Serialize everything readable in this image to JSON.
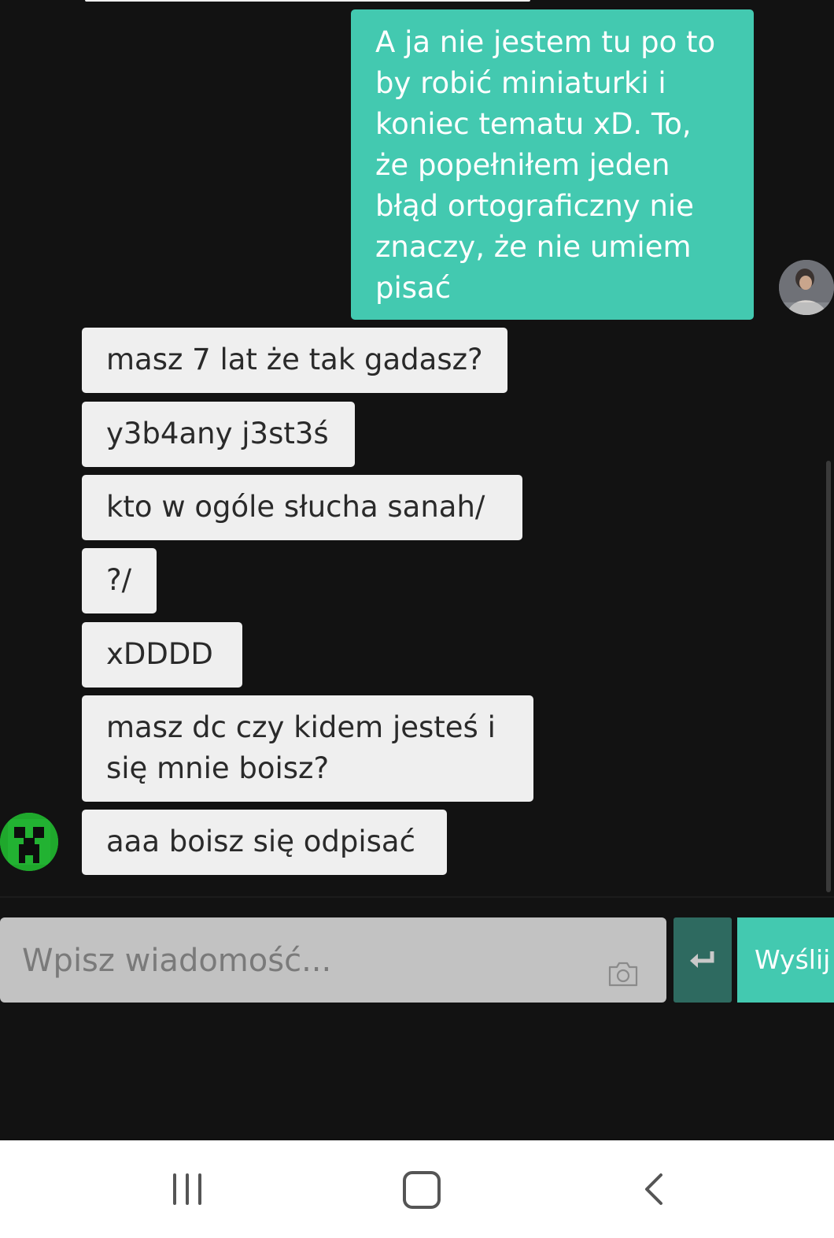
{
  "conversation": {
    "outgoing": [
      {
        "text": "A ja nie jestem tu po to\nby robić miniaturki i\nkoniec tematu xD. To,\nże popełniłem jeden\nbłąd ortograficzny nie\nznaczy, że nie umiem\npisać"
      }
    ],
    "incoming": [
      {
        "text": "masz 7 lat że tak gadasz?"
      },
      {
        "text": "y3b4any j3st3ś"
      },
      {
        "text": "kto w ogóle słucha sanah/"
      },
      {
        "text": "?/"
      },
      {
        "text": "xDDDD"
      },
      {
        "text": "masz dc czy kidem jesteś i\nsię mnie boisz?"
      },
      {
        "text": "aaa boisz się odpisać"
      }
    ],
    "partner_avatar_icon": "creeper-face-icon",
    "own_avatar_icon": "user-photo-avatar"
  },
  "composer": {
    "placeholder": "Wpisz wiadomość...",
    "value": "",
    "camera_icon": "camera-icon",
    "enter_icon": "enter-return-icon",
    "send_label": "Wyślij"
  },
  "system_nav": {
    "recents_icon": "recent-apps-icon",
    "home_icon": "home-icon",
    "back_icon": "back-chevron-icon"
  },
  "colors": {
    "background": "#121212",
    "accent": "#43c9b0",
    "accent_dark": "#2e6a60",
    "incoming_bubble": "#efefef",
    "input_bg": "#c2c2c2"
  }
}
